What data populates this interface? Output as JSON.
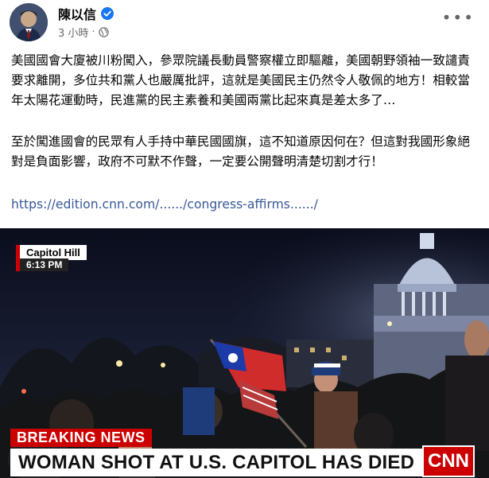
{
  "post": {
    "author": "陳以信",
    "time": "3 小時",
    "separator": "·",
    "more_label": "•••",
    "paragraphs": [
      "美國國會大廈被川粉闖入，參眾院議長動員警察權立即驅離，美國朝野領袖一致譴責要求離開，多位共和黨人也嚴厲批評，這就是美國民主仍然令人敬佩的地方！相較當年太陽花運動時，民進黨的民主素養和美國兩黨比起來真是差太多了…",
      "至於闖進國會的民眾有人手持中華民國國旗，這不知道原因何在？但這對我國形象絕對是負面影響，政府不可默不作聲，一定要公開聲明清楚切割才行！"
    ],
    "link": "https://edition.cnn.com/....../congress-affirms....../"
  },
  "video": {
    "location": "Capitol Hill",
    "time": "6:13 PM",
    "breaking": "BREAKING NEWS",
    "headline": "WOMAN SHOT AT U.S. CAPITOL HAS DIED",
    "logo": "CNN"
  },
  "colors": {
    "verified": "#1877f2",
    "link": "#385898",
    "meta": "#65676b",
    "cnn_red": "#cc0000"
  },
  "icons": [
    "verified-badge-icon",
    "globe-icon",
    "more-options-icon"
  ]
}
